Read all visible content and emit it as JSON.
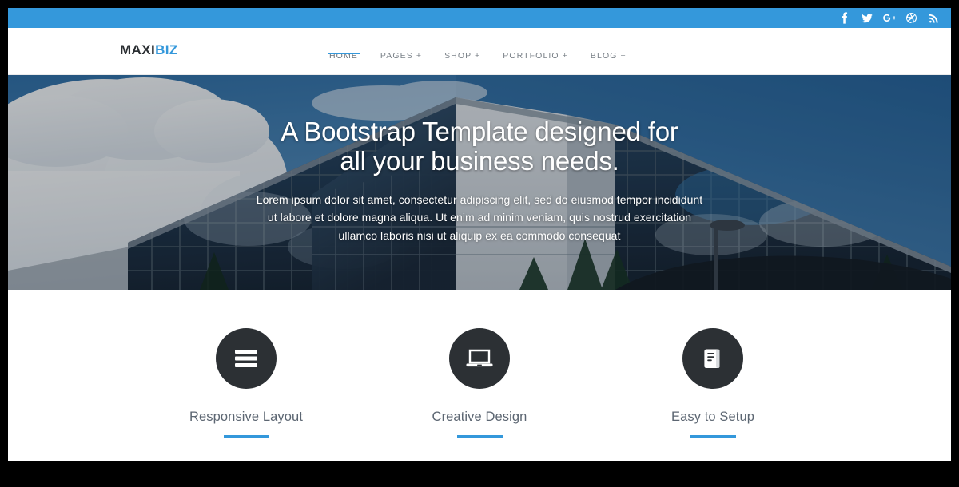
{
  "site": {
    "logo_primary": "MAXI",
    "logo_accent": "BIZ",
    "accent_color": "#3498db",
    "dark_color": "#2c3034"
  },
  "topbar": {
    "social": [
      {
        "name": "facebook-icon",
        "label": "Facebook"
      },
      {
        "name": "twitter-icon",
        "label": "Twitter"
      },
      {
        "name": "google-plus-icon",
        "label": "Google Plus"
      },
      {
        "name": "dribbble-icon",
        "label": "Dribbble"
      },
      {
        "name": "rss-icon",
        "label": "RSS"
      }
    ]
  },
  "nav": {
    "items": [
      {
        "label": "HOME",
        "active": true
      },
      {
        "label": "PAGES +",
        "active": false
      },
      {
        "label": "SHOP +",
        "active": false
      },
      {
        "label": "PORTFOLIO +",
        "active": false
      },
      {
        "label": "BLOG +",
        "active": false
      }
    ]
  },
  "hero": {
    "title_line1": "A Bootstrap Template designed for",
    "title_line2": "all your business needs.",
    "subtitle": "Lorem ipsum dolor sit amet, consectetur adipiscing elit, sed do eiusmod tempor incididunt ut labore et dolore magna aliqua. Ut enim ad minim veniam, quis nostrud exercitation ullamco laboris nisi ut aliquip ex ea commodo consequat"
  },
  "features": [
    {
      "title": "Responsive Layout",
      "icon": "bars-icon"
    },
    {
      "title": "Creative Design",
      "icon": "laptop-icon"
    },
    {
      "title": "Easy to Setup",
      "icon": "book-icon"
    }
  ]
}
